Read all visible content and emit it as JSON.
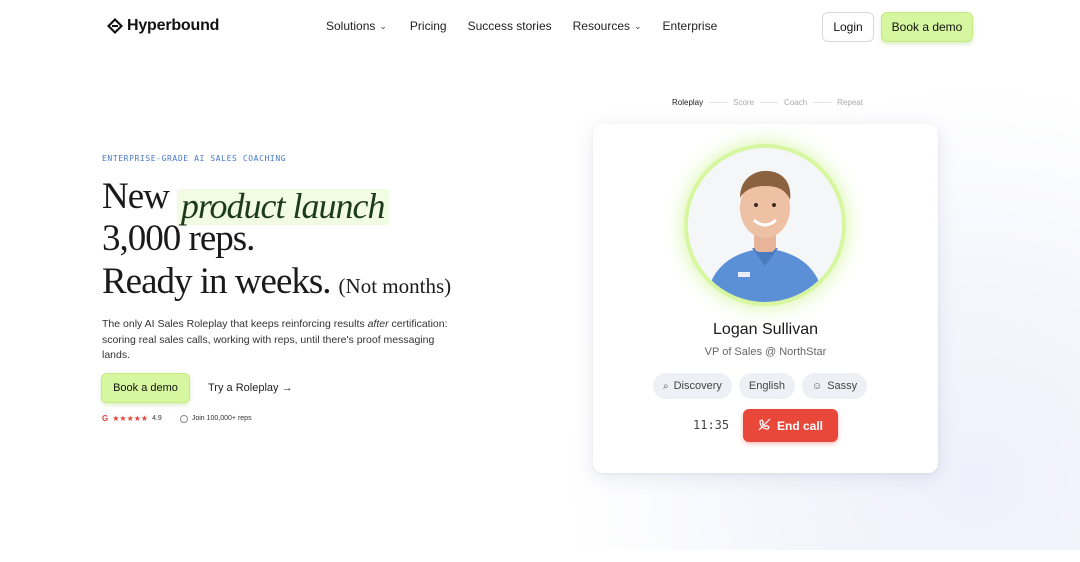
{
  "brand": {
    "name": "Hyperbound",
    "accent": "#d6f7a0",
    "danger": "#e8473a"
  },
  "nav": {
    "items": [
      {
        "label": "Solutions",
        "has_dropdown": true
      },
      {
        "label": "Pricing",
        "has_dropdown": false
      },
      {
        "label": "Success stories",
        "has_dropdown": false
      },
      {
        "label": "Resources",
        "has_dropdown": true
      },
      {
        "label": "Enterprise",
        "has_dropdown": false
      }
    ],
    "login_label": "Login",
    "demo_label": "Book a demo"
  },
  "hero": {
    "eyebrow": "ENTERPRISE-GRADE AI SALES COACHING",
    "line1_word": "New",
    "line1_accent": "product launch",
    "line2": "3,000 reps.",
    "line3_main": "Ready in weeks.",
    "line3_aside": "(Not months)",
    "lede_before": "The only AI Sales Roleplay that keeps reinforcing results ",
    "lede_em": "after",
    "lede_after": " certification: scoring real sales calls, working with reps, until there's proof messaging lands.",
    "cta_primary": "Book a demo",
    "cta_secondary": "Try a Roleplay →",
    "rating_icon": "G",
    "stars": "★★★★★",
    "rating_value": "4.9",
    "join_text": "Join 100,000+ reps"
  },
  "stepper": {
    "steps": [
      "Roleplay",
      "Score",
      "Coach",
      "Repeat"
    ],
    "active_index": 0
  },
  "call_card": {
    "name": "Logan Sullivan",
    "role": "VP of Sales @ NorthStar",
    "chips": [
      {
        "label": "Discovery",
        "icon": "search-icon"
      },
      {
        "label": "English",
        "icon": ""
      },
      {
        "label": "Sassy",
        "icon": "smile-icon"
      }
    ],
    "timer": "11:35",
    "end_call_label": "End call"
  }
}
